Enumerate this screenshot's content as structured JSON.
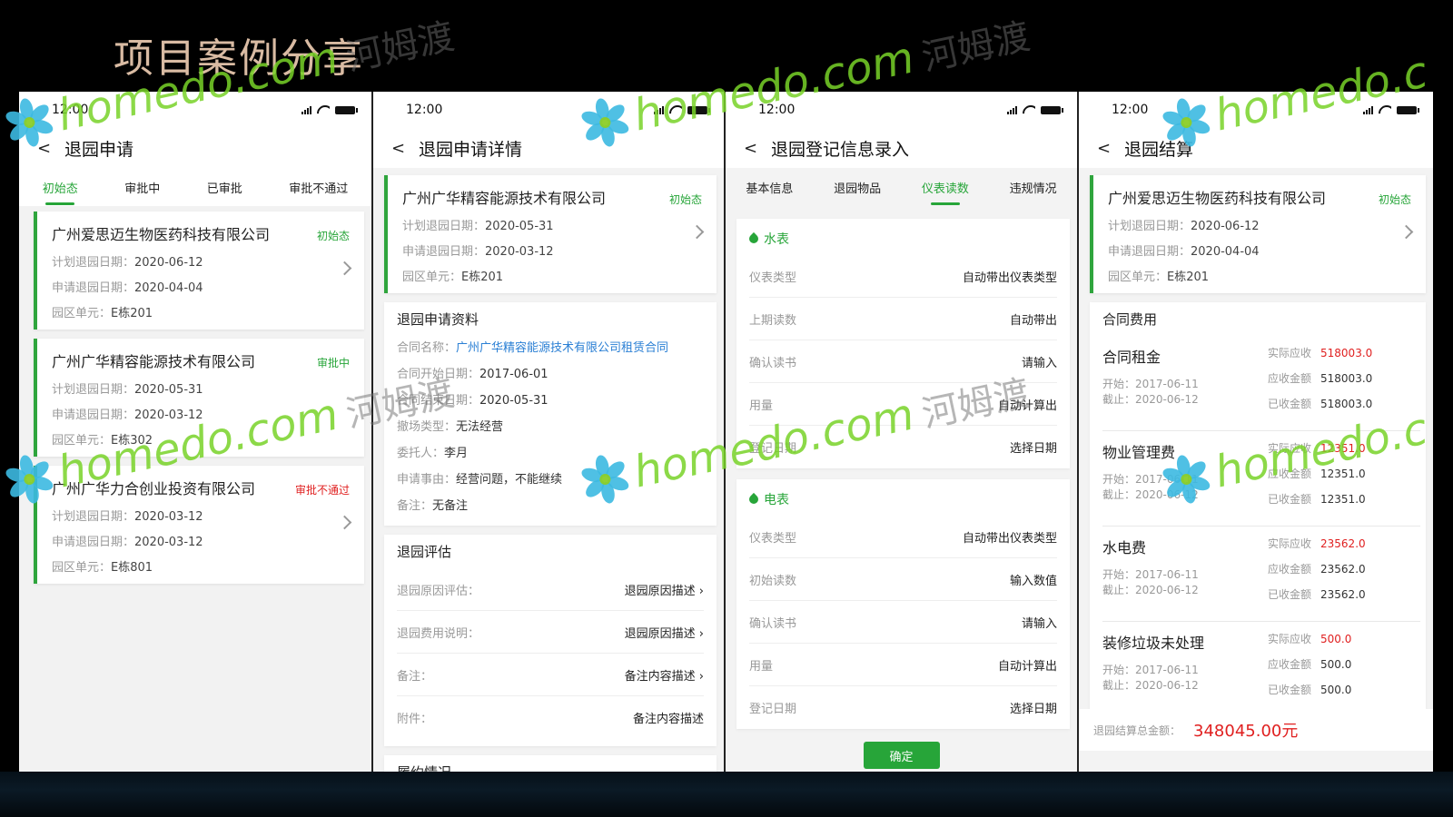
{
  "slide_title": "项目案例分享",
  "watermark": {
    "site": "homedo.com",
    "cn": "河姆渡",
    "wordmark": "homedo.c"
  },
  "colors": {
    "accent_green": "#27a539",
    "alert_red": "#e02020",
    "link_blue": "#2a7fd4"
  },
  "screen1": {
    "time": "12:00",
    "title": "退园申请",
    "tabs": [
      "初始态",
      "审批中",
      "已审批",
      "审批不通过"
    ],
    "cards": [
      {
        "company": "广州爱思迈生物医药科技有限公司",
        "status": "初始态",
        "plan_label": "计划退园日期：",
        "plan": "2020-06-12",
        "apply_label": "申请退园日期：",
        "apply": "2020-04-04",
        "unit_label": "园区单元：",
        "unit": "E栋201"
      },
      {
        "company": "广州广华精容能源技术有限公司",
        "status": "审批中",
        "plan_label": "计划退园日期：",
        "plan": "2020-05-31",
        "apply_label": "申请退园日期：",
        "apply": "2020-03-12",
        "unit_label": "园区单元：",
        "unit": "E栋302"
      },
      {
        "company": "广州广华力合创业投资有限公司",
        "status": "审批不通过",
        "plan_label": "计划退园日期：",
        "plan": "2020-03-12",
        "apply_label": "申请退园日期：",
        "apply": "2020-03-12",
        "unit_label": "园区单元：",
        "unit": "E栋801"
      }
    ]
  },
  "screen2": {
    "time": "12:00",
    "title": "退园申请详情",
    "card": {
      "company": "广州广华精容能源技术有限公司",
      "status": "初始态",
      "plan_label": "计划退园日期：",
      "plan": "2020-05-31",
      "apply_label": "申请退园日期：",
      "apply": "2020-03-12",
      "unit_label": "园区单元：",
      "unit": "E栋201"
    },
    "materials": {
      "title": "退园申请资料",
      "contract_label": "合同名称：",
      "contract": "广州广华精容能源技术有限公司租赁合同",
      "start_label": "合同开始日期：",
      "start": "2017-06-01",
      "end_label": "合同结束日期：",
      "end": "2020-05-31",
      "type_label": "撤场类型：",
      "type": "无法经营",
      "agent_label": "委托人：",
      "agent": "李月",
      "reason_label": "申请事由：",
      "reason": "经营问题，不能继续",
      "note_label": "备注：",
      "note": "无备注"
    },
    "evaluation": {
      "title": "退园评估",
      "rows": [
        {
          "label": "退园原因评估：",
          "value": "退园原因描述",
          "arrow": "›"
        },
        {
          "label": "退园费用说明：",
          "value": "退园原因描述",
          "arrow": "›"
        },
        {
          "label": "备注：",
          "value": "备注内容描述",
          "arrow": "›"
        },
        {
          "label": "附件：",
          "value": "备注内容描述",
          "arrow": ""
        }
      ]
    },
    "next_section": "履约情况"
  },
  "screen3": {
    "time": "12:00",
    "title": "退园登记信息录入",
    "tabs": [
      "基本信息",
      "退园物品",
      "仪表读数",
      "违规情况"
    ],
    "water": {
      "title": "水表",
      "rows": [
        {
          "label": "仪表类型",
          "value": "自动带出仪表类型"
        },
        {
          "label": "上期读数",
          "value": "自动带出"
        },
        {
          "label": "确认读书",
          "value": "请输入"
        },
        {
          "label": "用量",
          "value": "自动计算出"
        },
        {
          "label": "登记日期",
          "value": "选择日期"
        }
      ]
    },
    "electric": {
      "title": "电表",
      "rows": [
        {
          "label": "仪表类型",
          "value": "自动带出仪表类型"
        },
        {
          "label": "初始读数",
          "value": "输入数值"
        },
        {
          "label": "确认读书",
          "value": "请输入"
        },
        {
          "label": "用量",
          "value": "自动计算出"
        },
        {
          "label": "登记日期",
          "value": "选择日期"
        }
      ]
    },
    "confirm": "确定"
  },
  "screen4": {
    "time": "12:00",
    "title": "退园结算",
    "card": {
      "company": "广州爱思迈生物医药科技有限公司",
      "status": "初始态",
      "plan_label": "计划退园日期：",
      "plan": "2020-06-12",
      "apply_label": "申请退园日期：",
      "apply": "2020-04-04",
      "unit_label": "园区单元：",
      "unit": "E栋201"
    },
    "section_title": "合同费用",
    "fees": [
      {
        "name": "合同租金",
        "start": "开始：2017-06-11",
        "end": "截止：2020-06-12",
        "actual_label": "实际应收",
        "actual": "518003.0",
        "due_label": "应收金额",
        "due": "518003.0",
        "recv_label": "已收金额",
        "recv": "518003.0"
      },
      {
        "name": "物业管理费",
        "start": "开始：2017-06-11",
        "end": "截止：2020-06-12",
        "actual_label": "实际应收",
        "actual": "12351.0",
        "due_label": "应收金额",
        "due": "12351.0",
        "recv_label": "已收金额",
        "recv": "12351.0"
      },
      {
        "name": "水电费",
        "start": "开始：2017-06-11",
        "end": "截止：2020-06-12",
        "actual_label": "实际应收",
        "actual": "23562.0",
        "due_label": "应收金额",
        "due": "23562.0",
        "recv_label": "已收金额",
        "recv": "23562.0"
      },
      {
        "name": "装修垃圾未处理",
        "start": "开始：2017-06-11",
        "end": "截止：2020-06-12",
        "actual_label": "实际应收",
        "actual": "500.0",
        "due_label": "应收金额",
        "due": "500.0",
        "recv_label": "已收金额",
        "recv": "500.0"
      }
    ],
    "total_label": "退园结算总金额：",
    "total": "348045.00元"
  }
}
